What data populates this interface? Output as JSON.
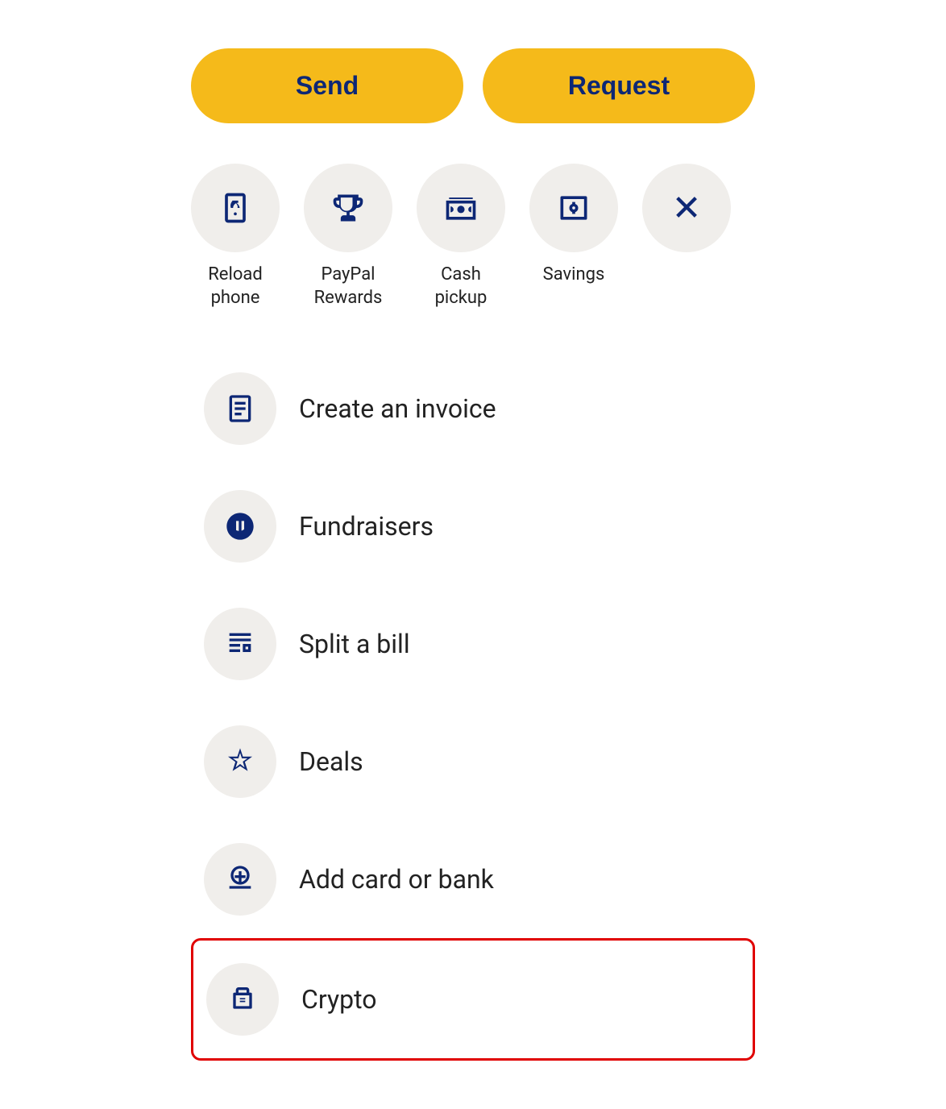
{
  "actions": {
    "send_label": "Send",
    "request_label": "Request"
  },
  "quick_actions": [
    {
      "id": "reload-phone",
      "label": "Reload\nphone",
      "label_line1": "Reload",
      "label_line2": "phone",
      "icon": "reload-phone-icon"
    },
    {
      "id": "paypal-rewards",
      "label": "PayPal\nRewards",
      "label_line1": "PayPal",
      "label_line2": "Rewards",
      "icon": "trophy-icon"
    },
    {
      "id": "cash-pickup",
      "label": "Cash\npickup",
      "label_line1": "Cash",
      "label_line2": "pickup",
      "icon": "cash-pickup-icon"
    },
    {
      "id": "savings",
      "label": "Savings",
      "label_line1": "Savings",
      "label_line2": "",
      "icon": "savings-icon"
    },
    {
      "id": "close",
      "label": "",
      "label_line1": "",
      "label_line2": "",
      "icon": "close-icon"
    }
  ],
  "list_items": [
    {
      "id": "create-invoice",
      "label": "Create an invoice",
      "icon": "invoice-icon",
      "highlighted": false
    },
    {
      "id": "fundraisers",
      "label": "Fundraisers",
      "icon": "fundraisers-icon",
      "highlighted": false
    },
    {
      "id": "split-bill",
      "label": "Split a bill",
      "icon": "split-bill-icon",
      "highlighted": false
    },
    {
      "id": "deals",
      "label": "Deals",
      "icon": "deals-icon",
      "highlighted": false
    },
    {
      "id": "add-card-bank",
      "label": "Add card or bank",
      "icon": "add-card-bank-icon",
      "highlighted": false
    },
    {
      "id": "crypto",
      "label": "Crypto",
      "icon": "crypto-icon",
      "highlighted": true
    }
  ],
  "colors": {
    "primary_yellow": "#F5BA1A",
    "primary_navy": "#0d2775",
    "circle_bg": "#f0eeeb",
    "highlight_border": "#e00000",
    "text_dark": "#222222"
  }
}
